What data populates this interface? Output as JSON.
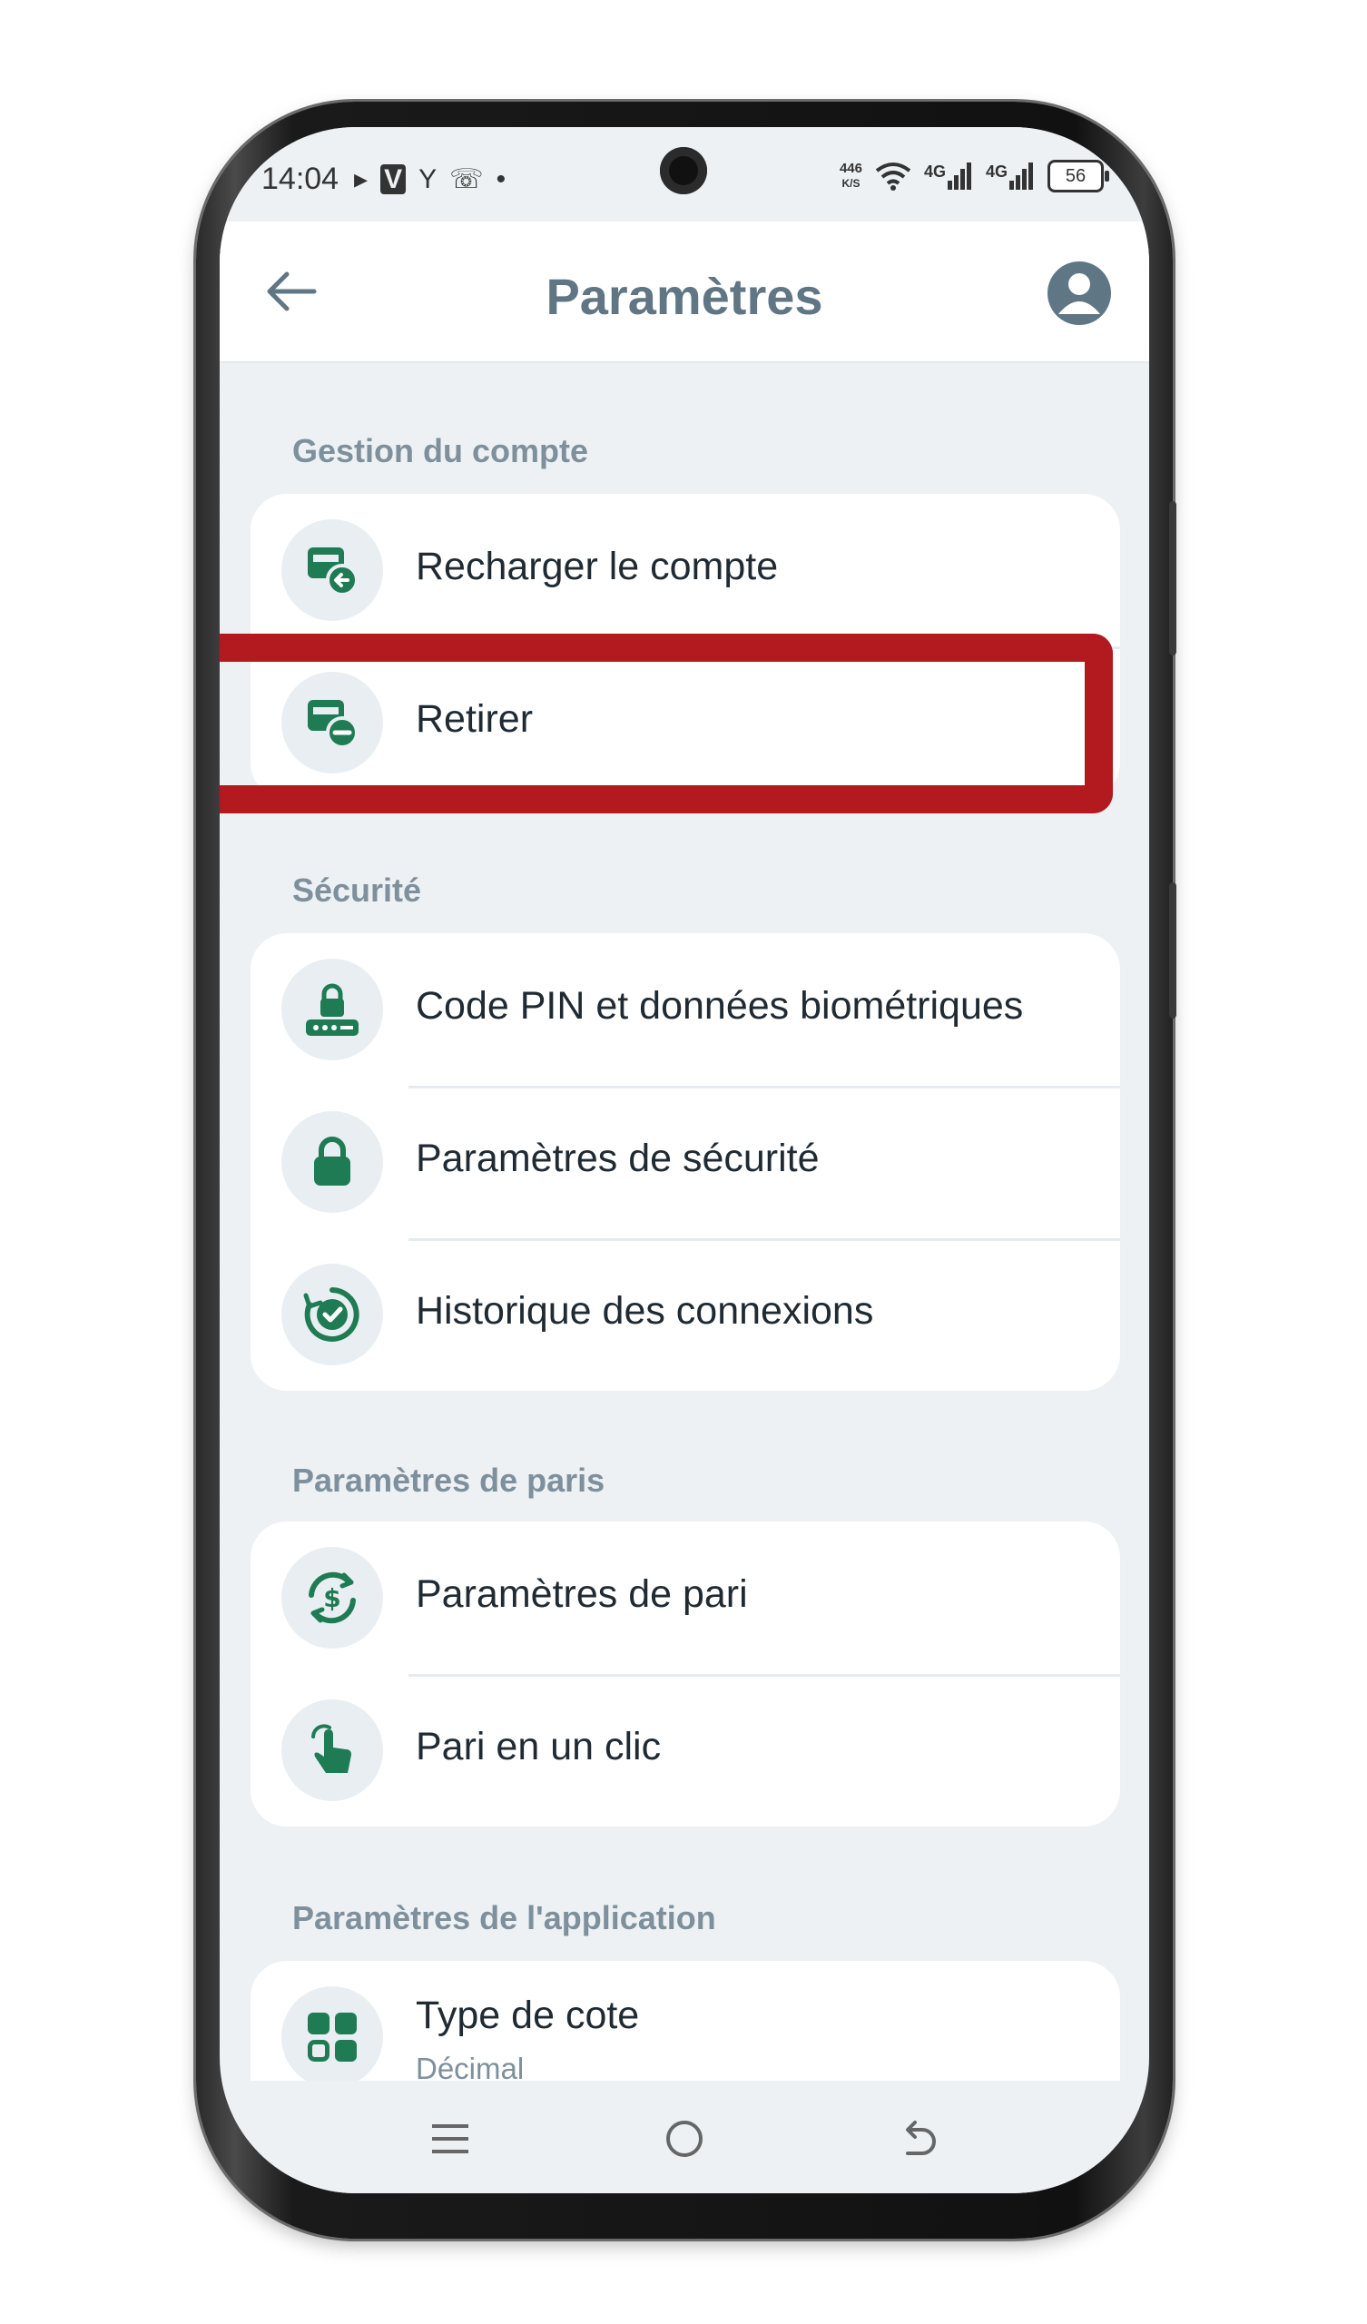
{
  "status_bar": {
    "time": "14:04",
    "left_icons": [
      "bing-icon",
      "v-app-icon",
      "yandex-icon",
      "whatsapp-icon",
      "dot-icon"
    ],
    "speed_value": "446",
    "speed_unit": "K/S",
    "signal1": "4G",
    "signal2": "4G",
    "battery": "56"
  },
  "header": {
    "title": "Paramètres",
    "back_icon": "arrow-left-icon",
    "profile_icon": "user-avatar-icon"
  },
  "sections": [
    {
      "title": "Gestion du compte",
      "items": [
        {
          "label": "Recharger le compte",
          "icon": "wallet-deposit-icon"
        },
        {
          "label": "Retirer",
          "icon": "wallet-withdraw-icon"
        }
      ]
    },
    {
      "title": "Sécurité",
      "items": [
        {
          "label": "Code PIN et données biométriques",
          "icon": "pin-lock-icon"
        },
        {
          "label": "Paramètres de sécurité",
          "icon": "lock-icon"
        },
        {
          "label": "Historique des connexions",
          "icon": "history-check-icon"
        }
      ]
    },
    {
      "title": "Paramètres de paris",
      "items": [
        {
          "label": "Paramètres de pari",
          "icon": "dollar-refresh-icon"
        },
        {
          "label": "Pari en un clic",
          "icon": "tap-hand-icon"
        }
      ]
    },
    {
      "title": "Paramètres de l'application",
      "items": [
        {
          "label": "Type de cote",
          "sublabel": "Décimal",
          "icon": "grid-apps-icon"
        }
      ]
    }
  ],
  "colors": {
    "accent_green": "#1e7b53",
    "title_gray": "#607684",
    "highlight_red": "#b31a1f",
    "background": "#edf1f4"
  },
  "navbar": {
    "icons": [
      "menu-icon",
      "home-circle-icon",
      "back-icon"
    ]
  }
}
